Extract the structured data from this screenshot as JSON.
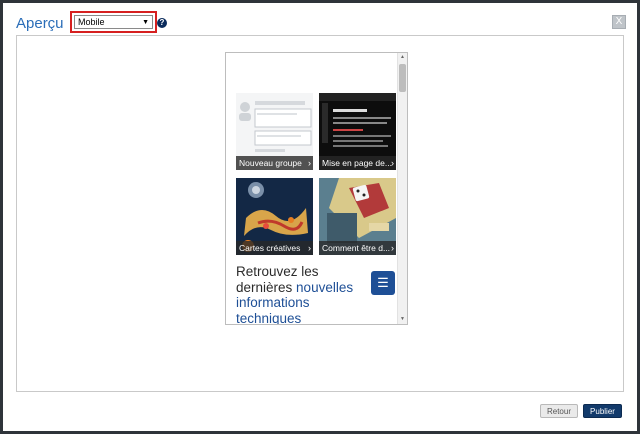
{
  "dialog": {
    "title": "Aperçu",
    "device_select": {
      "value": "Mobile",
      "options": [
        "Mobile"
      ]
    },
    "help_label": "?",
    "close_label": "X"
  },
  "preview": {
    "tiles": [
      {
        "caption": "Nouveau groupe"
      },
      {
        "caption": "Mise en page de..."
      },
      {
        "caption": "Cartes créatives"
      },
      {
        "caption": "Comment être d..."
      }
    ],
    "headline": {
      "line1": "Retrouvez les",
      "line2_a": "dernières ",
      "line2_b": "nouvelles",
      "line3": "informations",
      "line4": "techniques"
    }
  },
  "footer": {
    "back_label": "Retour",
    "publish_label": "Publier"
  },
  "colors": {
    "accent": "#2a6db8",
    "primary_button": "#123a6b",
    "highlight_border": "#d62020"
  }
}
